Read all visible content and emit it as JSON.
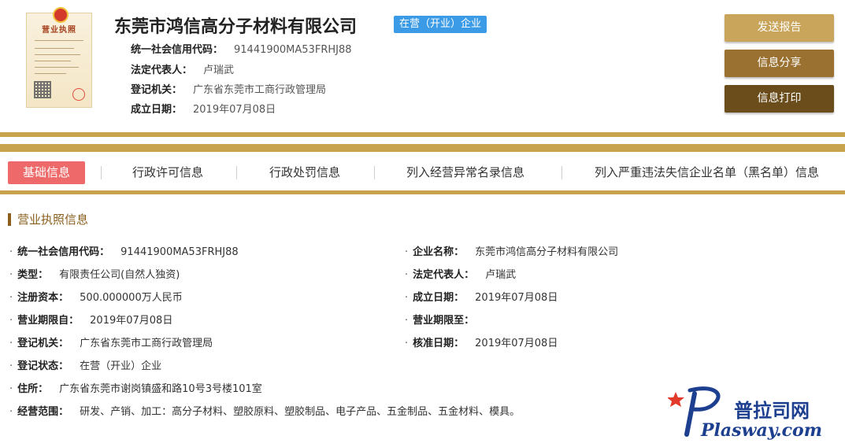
{
  "license_thumb": {
    "title": "营业执照"
  },
  "header": {
    "company_name": "东莞市鸿信高分子材料有限公司",
    "status_badge": "在营（开业）企业",
    "rows": [
      {
        "label": "统一社会信用代码：",
        "value": "91441900MA53FRHJ88"
      },
      {
        "label": "法定代表人：",
        "value": "卢瑞武"
      },
      {
        "label": "登记机关：",
        "value": "广东省东莞市工商行政管理局"
      },
      {
        "label": "成立日期：",
        "value": "2019年07月08日"
      }
    ]
  },
  "buttons": {
    "send_report": "发送报告",
    "share_info": "信息分享",
    "print_info": "信息打印"
  },
  "tabs": [
    {
      "label": "基础信息",
      "active": true
    },
    {
      "label": "行政许可信息",
      "active": false
    },
    {
      "label": "行政处罚信息",
      "active": false
    },
    {
      "label": "列入经营异常名录信息",
      "active": false
    },
    {
      "label": "列入严重违法失信企业名单（黑名单）信息",
      "active": false
    }
  ],
  "section": {
    "title": "营业执照信息",
    "bullet": "·",
    "left_fields": [
      {
        "label": "统一社会信用代码：",
        "value": "91441900MA53FRHJ88"
      },
      {
        "label": "类型：",
        "value": "有限责任公司(自然人独资)"
      },
      {
        "label": "注册资本：",
        "value": "500.000000万人民币"
      },
      {
        "label": "营业期限自：",
        "value": "2019年07月08日"
      },
      {
        "label": "登记机关：",
        "value": "广东省东莞市工商行政管理局"
      },
      {
        "label": "登记状态：",
        "value": "在营（开业）企业"
      },
      {
        "label": "住所：",
        "value": "广东省东莞市谢岗镇盛和路10号3号楼101室"
      },
      {
        "label": "经营范围：",
        "value": "研发、产销、加工：高分子材料、塑胶原料、塑胶制品、电子产品、五金制品、五金材料、模具。"
      }
    ],
    "right_fields": [
      {
        "label": "企业名称：",
        "value": "东莞市鸿信高分子材料有限公司"
      },
      {
        "label": "法定代表人：",
        "value": "卢瑞武"
      },
      {
        "label": "成立日期：",
        "value": "2019年07月08日"
      },
      {
        "label": "营业期限至：",
        "value": ""
      },
      {
        "label": "核准日期：",
        "value": "2019年07月08日"
      }
    ]
  },
  "watermark": {
    "cn": "普拉司网",
    "en": "Plasway.com"
  },
  "colors": {
    "gold_band": "#c7a34d",
    "active_tab": "#ee6a6a",
    "badge": "#3c9be6",
    "section_accent": "#8b5e1c"
  }
}
